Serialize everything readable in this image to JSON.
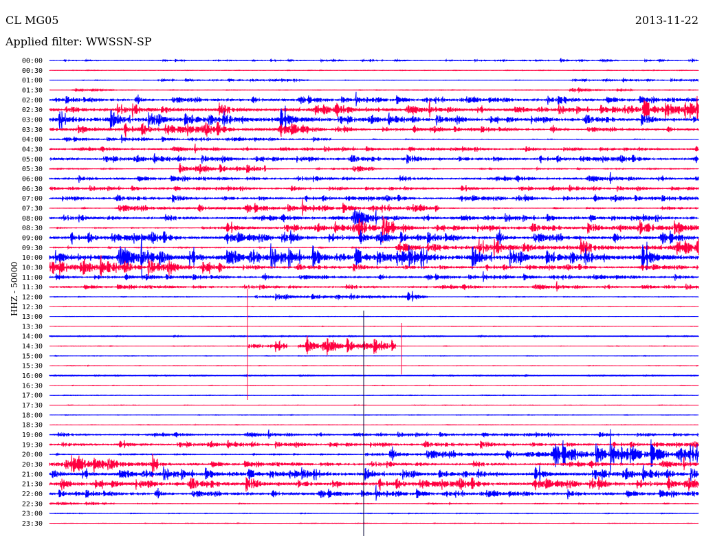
{
  "header": {
    "station": "CL MG05",
    "date": "2013-11-22",
    "filter": "Applied filter: WWSSN-SP"
  },
  "chart_data": {
    "type": "line",
    "title": "CL MG05 2013-11-22",
    "ylabel": "HHZ - 50000",
    "colors": [
      "#0000ff",
      "#ff0040"
    ],
    "rows": [
      {
        "label": "00:00",
        "base": 0.5,
        "seg": [
          [
            0,
            30,
            0.6
          ]
        ]
      },
      {
        "label": "00:30",
        "base": 0.4,
        "seg": []
      },
      {
        "label": "01:00",
        "base": 0.4,
        "seg": [
          [
            5,
            12,
            1
          ],
          [
            24,
            30,
            0.8
          ]
        ]
      },
      {
        "label": "01:30",
        "base": 0.3,
        "seg": [
          [
            1,
            3,
            1.5
          ],
          [
            24,
            27,
            1.5
          ]
        ]
      },
      {
        "label": "02:00",
        "base": 1,
        "seg": [
          [
            0,
            30,
            2.5
          ],
          [
            23.5,
            24.5,
            6
          ]
        ]
      },
      {
        "label": "02:30",
        "base": 1,
        "seg": [
          [
            0,
            16,
            5
          ],
          [
            16,
            30,
            3
          ],
          [
            26,
            30,
            6
          ]
        ]
      },
      {
        "label": "03:00",
        "base": 1.5,
        "seg": [
          [
            0,
            13,
            7
          ],
          [
            13,
            30,
            3
          ]
        ]
      },
      {
        "label": "03:30",
        "base": 1,
        "seg": [
          [
            0,
            12,
            5
          ],
          [
            12,
            30,
            2
          ]
        ]
      },
      {
        "label": "04:00",
        "base": 0.6,
        "seg": [
          [
            0,
            13,
            1.5
          ]
        ]
      },
      {
        "label": "04:30",
        "base": 1,
        "seg": [
          [
            0,
            30,
            1.5
          ]
        ]
      },
      {
        "label": "05:00",
        "base": 1,
        "seg": [
          [
            0,
            30,
            2.5
          ]
        ]
      },
      {
        "label": "05:30",
        "base": 1,
        "seg": [
          [
            6,
            10,
            3
          ],
          [
            13,
            15,
            2.5
          ]
        ]
      },
      {
        "label": "06:00",
        "base": 1,
        "seg": [
          [
            0,
            30,
            2
          ]
        ]
      },
      {
        "label": "06:30",
        "base": 1,
        "seg": [
          [
            0,
            30,
            1.5
          ]
        ]
      },
      {
        "label": "07:00",
        "base": 1,
        "seg": [
          [
            0,
            30,
            2
          ]
        ]
      },
      {
        "label": "07:30",
        "base": 1,
        "seg": [
          [
            3,
            18,
            3
          ],
          [
            28,
            30,
            2
          ]
        ]
      },
      {
        "label": "08:00",
        "base": 1,
        "seg": [
          [
            0,
            30,
            2.5
          ],
          [
            13,
            15,
            4
          ]
        ]
      },
      {
        "label": "08:30",
        "base": 1,
        "seg": [
          [
            7,
            30,
            3
          ],
          [
            14,
            16,
            6
          ],
          [
            26,
            30,
            6
          ]
        ]
      },
      {
        "label": "09:00",
        "base": 1.5,
        "seg": [
          [
            0,
            30,
            4
          ]
        ]
      },
      {
        "label": "09:30",
        "base": 1,
        "seg": [
          [
            16,
            30,
            7
          ]
        ]
      },
      {
        "label": "10:00",
        "base": 1.5,
        "seg": [
          [
            0,
            30,
            8
          ]
        ]
      },
      {
        "label": "10:30",
        "base": 1,
        "seg": [
          [
            0,
            8,
            6
          ],
          [
            8,
            30,
            2
          ]
        ]
      },
      {
        "label": "11:00",
        "base": 1.5,
        "seg": [
          [
            0,
            30,
            1.5
          ]
        ]
      },
      {
        "label": "11:30",
        "base": 1.2,
        "seg": [
          [
            0,
            30,
            1.5
          ]
        ]
      },
      {
        "label": "12:00",
        "base": 0.5,
        "seg": [
          [
            9.5,
            17.5,
            3
          ]
        ]
      },
      {
        "label": "12:30",
        "base": 0.3,
        "seg": []
      },
      {
        "label": "13:00",
        "base": 0.3,
        "seg": []
      },
      {
        "label": "13:30",
        "base": 0.3,
        "seg": []
      },
      {
        "label": "14:00",
        "base": 0.5,
        "seg": []
      },
      {
        "label": "14:30",
        "base": 0.4,
        "seg": [
          [
            9.2,
            11,
            6
          ],
          [
            11.5,
            16,
            6
          ]
        ]
      },
      {
        "label": "15:00",
        "base": 0.4,
        "seg": []
      },
      {
        "label": "15:30",
        "base": 0.4,
        "seg": []
      },
      {
        "label": "16:00",
        "base": 0.5,
        "seg": []
      },
      {
        "label": "16:30",
        "base": 0.4,
        "seg": []
      },
      {
        "label": "17:00",
        "base": 0.4,
        "seg": []
      },
      {
        "label": "17:30",
        "base": 0.4,
        "seg": []
      },
      {
        "label": "18:00",
        "base": 0.4,
        "seg": []
      },
      {
        "label": "18:30",
        "base": 0.4,
        "seg": []
      },
      {
        "label": "19:00",
        "base": 0.8,
        "seg": [
          [
            0,
            30,
            1.5
          ]
        ]
      },
      {
        "label": "19:30",
        "base": 1,
        "seg": [
          [
            0,
            30,
            2
          ]
        ]
      },
      {
        "label": "20:00",
        "base": 1,
        "seg": [
          [
            14.6,
            22,
            4
          ],
          [
            22,
            30,
            9
          ]
        ]
      },
      {
        "label": "20:30",
        "base": 1.5,
        "seg": [
          [
            0,
            5,
            7
          ],
          [
            5,
            30,
            2
          ]
        ]
      },
      {
        "label": "21:00",
        "base": 1.5,
        "seg": [
          [
            0,
            30,
            4
          ]
        ]
      },
      {
        "label": "21:30",
        "base": 1.5,
        "seg": [
          [
            0,
            30,
            4
          ]
        ]
      },
      {
        "label": "22:00",
        "base": 1.5,
        "seg": [
          [
            0,
            30,
            2.5
          ]
        ]
      },
      {
        "label": "22:30",
        "base": 0.8,
        "seg": [
          [
            0,
            3,
            2
          ]
        ]
      },
      {
        "label": "23:00",
        "base": 0.5,
        "seg": []
      },
      {
        "label": "23:30",
        "base": 0.4,
        "seg": []
      }
    ]
  }
}
